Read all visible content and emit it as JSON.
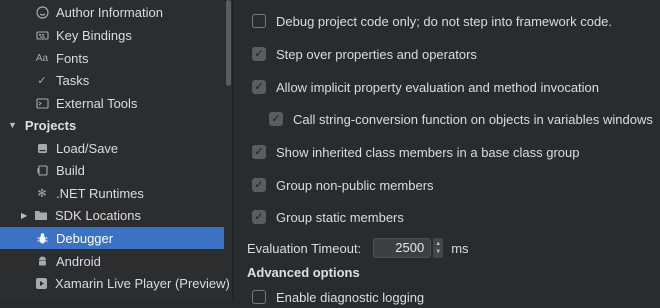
{
  "sidebar": {
    "items": [
      {
        "label": "Author Information",
        "icon": "user-circle-icon",
        "type": "child",
        "selected": false
      },
      {
        "label": "Key Bindings",
        "icon": "keyboard-icon",
        "type": "child",
        "selected": false
      },
      {
        "label": "Fonts",
        "icon": "font-icon",
        "type": "child",
        "selected": false
      },
      {
        "label": "Tasks",
        "icon": "checkmark-icon",
        "type": "child",
        "selected": false
      },
      {
        "label": "External Tools",
        "icon": "terminal-icon",
        "type": "child",
        "selected": false
      },
      {
        "label": "Projects",
        "icon": "disclosure-down-icon",
        "type": "section",
        "selected": false
      },
      {
        "label": "Load/Save",
        "icon": "hard-drive-icon",
        "type": "child",
        "selected": false
      },
      {
        "label": "Build",
        "icon": "build-icon",
        "type": "child",
        "selected": false
      },
      {
        "label": ".NET Runtimes",
        "icon": "gear-icon",
        "type": "child",
        "selected": false
      },
      {
        "label": "SDK Locations",
        "icon": "folder-icon",
        "type": "folder",
        "selected": false
      },
      {
        "label": "Debugger",
        "icon": "bug-icon",
        "type": "child",
        "selected": true
      },
      {
        "label": "Android",
        "icon": "android-icon",
        "type": "child",
        "selected": false
      },
      {
        "label": "Xamarin Live Player (Preview)",
        "icon": "play-icon",
        "type": "child",
        "selected": false
      }
    ]
  },
  "debugger": {
    "options": [
      {
        "label": "Debug project code only; do not step into framework code.",
        "checked": false,
        "indent": false
      },
      {
        "label": "Step over properties and operators",
        "checked": true,
        "indent": false
      },
      {
        "label": "Allow implicit property evaluation and method invocation",
        "checked": true,
        "indent": false
      },
      {
        "label": "Call string-conversion function on objects in variables windows",
        "checked": true,
        "indent": true
      },
      {
        "label": "Show inherited class members in a base class group",
        "checked": true,
        "indent": false
      },
      {
        "label": "Group non-public members",
        "checked": true,
        "indent": false
      },
      {
        "label": "Group static members",
        "checked": true,
        "indent": false
      }
    ],
    "timeout_label": "Evaluation Timeout:",
    "timeout_value": "2500",
    "timeout_unit": "ms",
    "advanced_heading": "Advanced options",
    "advanced_options": [
      {
        "label": "Enable diagnostic logging",
        "checked": false
      }
    ]
  },
  "colors": {
    "selection": "#3a73c6",
    "background": "#2a2b2d"
  }
}
